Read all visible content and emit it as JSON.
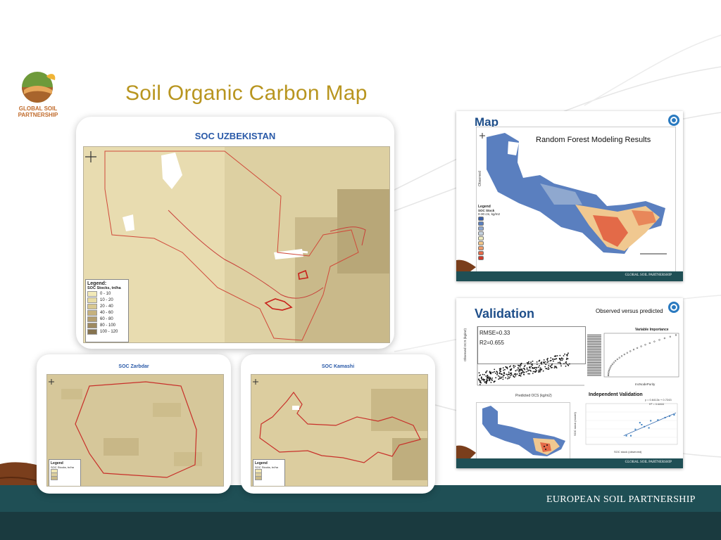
{
  "slide": {
    "title": "Soil Organic Carbon Map",
    "logo": {
      "line1": "GLOBAL SOIL",
      "line2": "PARTNERSHIP"
    },
    "footer_text": "EUROPEAN SOIL PARTNERSHIP"
  },
  "uzbekistan_map": {
    "title": "SOC UZBEKISTAN",
    "legend_title": "Legend:",
    "legend_subtitle": "SOC Stocks, tn/ha",
    "legend_items": [
      {
        "label": "0 - 10",
        "color": "#f3eab8"
      },
      {
        "label": "10 - 20",
        "color": "#e8dca4"
      },
      {
        "label": "20 - 40",
        "color": "#d8c891"
      },
      {
        "label": "40 - 60",
        "color": "#c6b27e"
      },
      {
        "label": "60 - 80",
        "color": "#b49f70"
      },
      {
        "label": "80 - 100",
        "color": "#9e8a60"
      },
      {
        "label": "100 - 120",
        "color": "#86734f"
      }
    ]
  },
  "zarbdar_map": {
    "title": "SOC Zarbdar",
    "legend_title": "Legend",
    "legend_subtitle": "SOC Stocks, tn/ha"
  },
  "kamashi_map": {
    "title": "SOC Kamashi",
    "legend_title": "Legend",
    "legend_subtitle": "SOC Stocks, tn/ha"
  },
  "rf_slide": {
    "heading": "Map",
    "subtitle": "Random Forest Modeling Results",
    "axis_label": "Observed",
    "legend_title": "Legend",
    "legend_subtitle": "SOC Stock",
    "legend_subtitle2": "0-30 cm, kg/m2",
    "legend_colors": [
      "#3a5fa8",
      "#5a7fbf",
      "#8fa8cf",
      "#c5d2e0",
      "#f0ecc0",
      "#f2c68a",
      "#ee9a6a",
      "#e36a48",
      "#cf3a2a"
    ],
    "footer": "GLOBAL SOIL PARTNERSHIP"
  },
  "validation_slide": {
    "heading": "Validation",
    "subtitle": "Observed versus predicted",
    "rmse": "RMSE=0.33",
    "r2": "R2=0.655",
    "scatter_xlabel": "Predicted OCS (kg/m2)",
    "scatter_ylabel": "Observed OCS (kg/m2)",
    "vi_title": "Variable Importance",
    "vi_xlabel": "IncNodePurity",
    "indep_title": "Independent Validation",
    "indep_eq": "y = 0.6413x + 0.7243",
    "indep_r2": "R² = 0.6853",
    "indep_xlabel": "SOC stock (observed)",
    "indep_ylabel": "SOC stock (model)",
    "footer": "GLOBAL SOIL PARTNERSHIP"
  }
}
